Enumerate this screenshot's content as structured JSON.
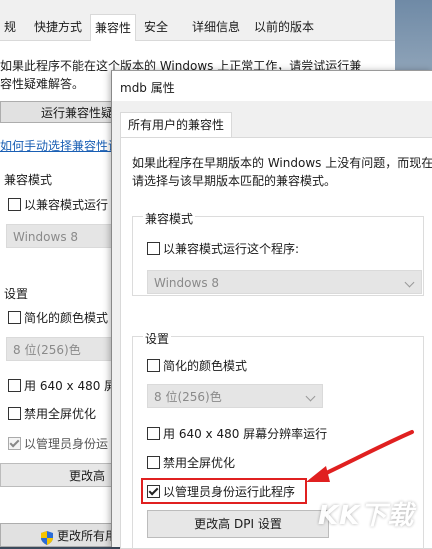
{
  "bg": {
    "tabs": [
      "规",
      "快捷方式",
      "兼容性",
      "安全",
      "详细信息",
      "以前的版本"
    ],
    "intro_line1": "如果此程序不能在这个版本的 Windows 上正常工作，请尝试运行兼",
    "intro_line2": "容性疑难解答。",
    "troubleshoot_button": "运行兼容性疑",
    "manual_link": "如何手动选择兼容性设",
    "compat_mode_label": "兼容模式",
    "compat_checkbox": "以兼容模式运行",
    "os_select": "Windows 8",
    "settings_label": "设置",
    "reduced_color": "简化的颜色模式",
    "color_select": "8 位(256)色",
    "res_640": "用 640 x 480 屏",
    "disable_fullscreen": "禁用全屏优化",
    "run_as_admin": "以管理员身份运",
    "change_dpi_button": "更改高",
    "change_all_users_button": "更改所有用"
  },
  "dlg": {
    "title": "mdb 属性",
    "tab": "所有用户的兼容性",
    "intro_line1": "如果此程序在早期版本的 Windows 上没有问题，而现在",
    "intro_line2": "请选择与该早期版本匹配的兼容模式。",
    "compat_group_label": "兼容模式",
    "compat_checkbox": "以兼容模式运行这个程序:",
    "os_select": "Windows 8",
    "settings_group_label": "设置",
    "reduced_color": "简化的颜色模式",
    "color_select": "8 位(256)色",
    "res_640": "用 640 x 480 屏幕分辨率运行",
    "disable_fullscreen": "禁用全屏优化",
    "run_as_admin": "以管理员身份运行此程序",
    "change_dpi_button": "更改高 DPI 设置"
  },
  "watermark": {
    "brand": "KK下载",
    "url": "www.kkx.net"
  },
  "colors": {
    "annotation_red": "#e02020",
    "link_blue": "#1a5fb4"
  }
}
